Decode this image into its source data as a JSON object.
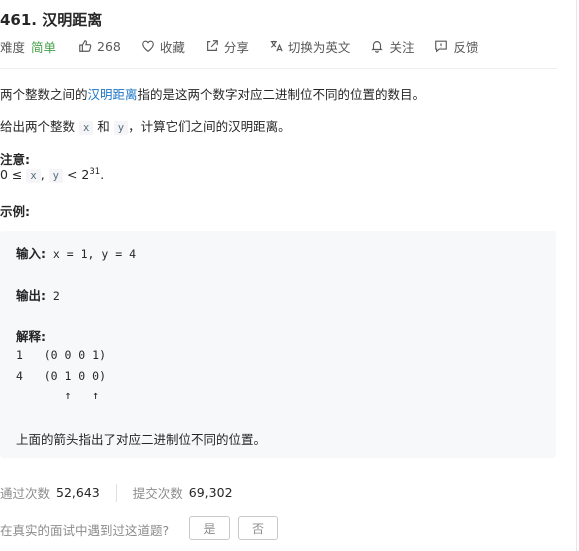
{
  "problem": {
    "title": "461. 汉明距离"
  },
  "meta": {
    "difficulty_label": "难度",
    "difficulty": "简单",
    "likes": "268",
    "favorite": "收藏",
    "share": "分享",
    "translate": "切换为英文",
    "follow": "关注",
    "feedback": "反馈"
  },
  "description": {
    "p1_before": "两个整数之间的",
    "p1_link": "汉明距离",
    "p1_after": "指的是这两个数字对应二进制位不同的位置的数目。",
    "p2_before": "给出两个整数 ",
    "var_x": "x",
    "p2_and": " 和 ",
    "var_y": "y",
    "p2_after": "，计算它们之间的汉明距离。",
    "note_heading": "注意:",
    "note_prefix": "0 ≤ ",
    "note_sep": ", ",
    "note_lt": " < 2",
    "note_exp": "31",
    "note_end": ".",
    "example_heading": "示例:"
  },
  "example": {
    "input_label": "输入:",
    "input_value": " x = 1, y = 4",
    "output_label": "输出:",
    "output_value": " 2",
    "explain_label": "解释:",
    "line1": "1   (0 0 0 1)",
    "line2": "4   (0 1 0 0)",
    "arrows": "       ↑   ↑",
    "explain_text": "上面的箭头指出了对应二进制位不同的位置。"
  },
  "stats": {
    "accepted_label": "通过次数",
    "accepted_value": "52,643",
    "submissions_label": "提交次数",
    "submissions_value": "69,302"
  },
  "interview": {
    "question": "在真实的面试中遇到过这道题?",
    "yes": "是",
    "no": "否"
  },
  "colors": {
    "easy": "#43a047",
    "link": "#1a73c7",
    "muted": "#8c8c8c"
  }
}
